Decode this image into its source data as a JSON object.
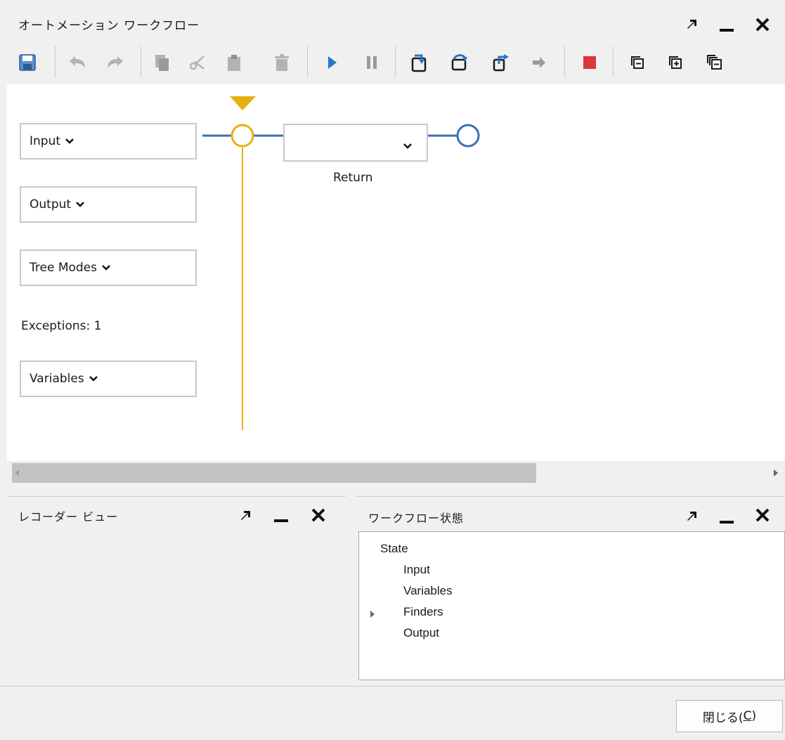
{
  "window": {
    "title": "オートメーション ワークフロー"
  },
  "toolbar": {
    "buttons": [
      "save-icon",
      "undo-icon",
      "redo-icon",
      "copy-icon",
      "cut-icon",
      "paste-icon",
      "delete-icon",
      "play-icon",
      "pause-icon",
      "step-into-icon",
      "step-over-icon",
      "step-out-icon",
      "stop-recording-icon",
      "stop-icon",
      "collapse-icon",
      "expand-icon",
      "collapse-all-icon"
    ]
  },
  "canvas": {
    "input_label": "Input",
    "output_label": "Output",
    "tree_modes_label": "Tree Modes",
    "exceptions_label": "Exceptions: 1",
    "variables_label": "Variables",
    "return_label": "Return"
  },
  "recorder_panel": {
    "title": "レコーダー ビュー"
  },
  "workflow_state_panel": {
    "title": "ワークフロー状態",
    "tree": {
      "root": "State",
      "children": [
        "Input",
        "Variables",
        "Finders",
        "Output"
      ]
    }
  },
  "footer": {
    "close_label": "閉じる(",
    "close_accel": "C",
    "close_suffix": ")"
  },
  "colors": {
    "flow_blue": "#3d6fb6",
    "active_yellow": "#e6b011",
    "stop_red": "#d9363e",
    "toolbar_blue": "#2b74c7"
  }
}
